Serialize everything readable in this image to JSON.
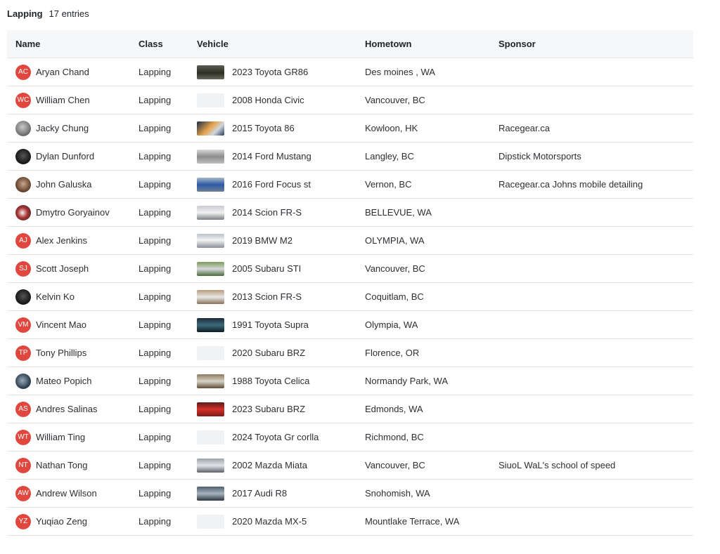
{
  "header": {
    "title": "Lapping",
    "count": "17 entries"
  },
  "table": {
    "columns": [
      "Name",
      "Class",
      "Vehicle",
      "Hometown",
      "Sponsor"
    ],
    "rows": [
      {
        "initials": "AC",
        "avatar": "initials",
        "name": "Aryan Chand",
        "class": "Lapping",
        "thumb": "t-gr86",
        "vehicle": "2023 Toyota GR86",
        "hometown": "Des moines , WA",
        "sponsor": ""
      },
      {
        "initials": "WC",
        "avatar": "initials",
        "name": "William Chen",
        "class": "Lapping",
        "thumb": "",
        "vehicle": "2008 Honda Civic",
        "hometown": "Vancouver, BC",
        "sponsor": ""
      },
      {
        "initials": "",
        "avatar": "photo",
        "name": "Jacky Chung",
        "class": "Lapping",
        "thumb": "t-86",
        "vehicle": "2015 Toyota 86",
        "hometown": "Kowloon, HK",
        "sponsor": "Racegear.ca"
      },
      {
        "initials": "",
        "avatar": "photo dark",
        "name": "Dylan Dunford",
        "class": "Lapping",
        "thumb": "t-mustang",
        "vehicle": "2014 Ford Mustang",
        "hometown": "Langley, BC",
        "sponsor": "Dipstick Motorsports"
      },
      {
        "initials": "",
        "avatar": "photo face",
        "name": "John Galuska",
        "class": "Lapping",
        "thumb": "t-focus",
        "vehicle": "2016 Ford Focus st",
        "hometown": "Vernon, BC",
        "sponsor": "Racegear.ca Johns mobile detailing"
      },
      {
        "initials": "",
        "avatar": "photo mixed",
        "name": "Dmytro Goryainov",
        "class": "Lapping",
        "thumb": "t-frs1",
        "vehicle": "2014 Scion FR-S",
        "hometown": "BELLEVUE, WA",
        "sponsor": ""
      },
      {
        "initials": "AJ",
        "avatar": "initials",
        "name": "Alex Jenkins",
        "class": "Lapping",
        "thumb": "t-m2",
        "vehicle": "2019 BMW M2",
        "hometown": "OLYMPIA, WA",
        "sponsor": ""
      },
      {
        "initials": "SJ",
        "avatar": "initials",
        "name": "Scott Joseph",
        "class": "Lapping",
        "thumb": "t-sti",
        "vehicle": "2005 Subaru STI",
        "hometown": "Vancouver, BC",
        "sponsor": ""
      },
      {
        "initials": "",
        "avatar": "photo dark",
        "name": "Kelvin Ko",
        "class": "Lapping",
        "thumb": "t-frs2",
        "vehicle": "2013 Scion FR-S",
        "hometown": "Coquitlam, BC",
        "sponsor": ""
      },
      {
        "initials": "VM",
        "avatar": "initials",
        "name": "Vincent Mao",
        "class": "Lapping",
        "thumb": "t-supra",
        "vehicle": "1991 Toyota Supra",
        "hometown": "Olympia, WA",
        "sponsor": ""
      },
      {
        "initials": "TP",
        "avatar": "initials",
        "name": "Tony Phillips",
        "class": "Lapping",
        "thumb": "",
        "vehicle": "2020 Subaru BRZ",
        "hometown": "Florence, OR",
        "sponsor": ""
      },
      {
        "initials": "",
        "avatar": "photo blue",
        "name": "Mateo Popich",
        "class": "Lapping",
        "thumb": "t-celica",
        "vehicle": "1988 Toyota Celica",
        "hometown": "Normandy Park, WA",
        "sponsor": ""
      },
      {
        "initials": "AS",
        "avatar": "initials",
        "name": "Andres Salinas",
        "class": "Lapping",
        "thumb": "t-brz",
        "vehicle": "2023 Subaru BRZ",
        "hometown": "Edmonds, WA",
        "sponsor": ""
      },
      {
        "initials": "WT",
        "avatar": "initials",
        "name": "William Ting",
        "class": "Lapping",
        "thumb": "",
        "vehicle": "2024 Toyota Gr corlla",
        "hometown": "Richmond, BC",
        "sponsor": ""
      },
      {
        "initials": "NT",
        "avatar": "initials",
        "name": "Nathan Tong",
        "class": "Lapping",
        "thumb": "t-miata",
        "vehicle": "2002 Mazda Miata",
        "hometown": "Vancouver, BC",
        "sponsor": "SiuoL WaL's school of speed"
      },
      {
        "initials": "AW",
        "avatar": "initials",
        "name": "Andrew Wilson",
        "class": "Lapping",
        "thumb": "t-r8",
        "vehicle": "2017 Audi R8",
        "hometown": "Snohomish, WA",
        "sponsor": ""
      },
      {
        "initials": "YZ",
        "avatar": "initials",
        "name": "Yuqiao Zeng",
        "class": "Lapping",
        "thumb": "",
        "vehicle": "2020 Mazda MX-5",
        "hometown": "Mountlake Terrace, WA",
        "sponsor": ""
      }
    ]
  },
  "colors": {
    "avatar_initials_bg": "#e0473f",
    "header_bg": "#f6f7f8",
    "row_border": "#e3e5e8"
  }
}
